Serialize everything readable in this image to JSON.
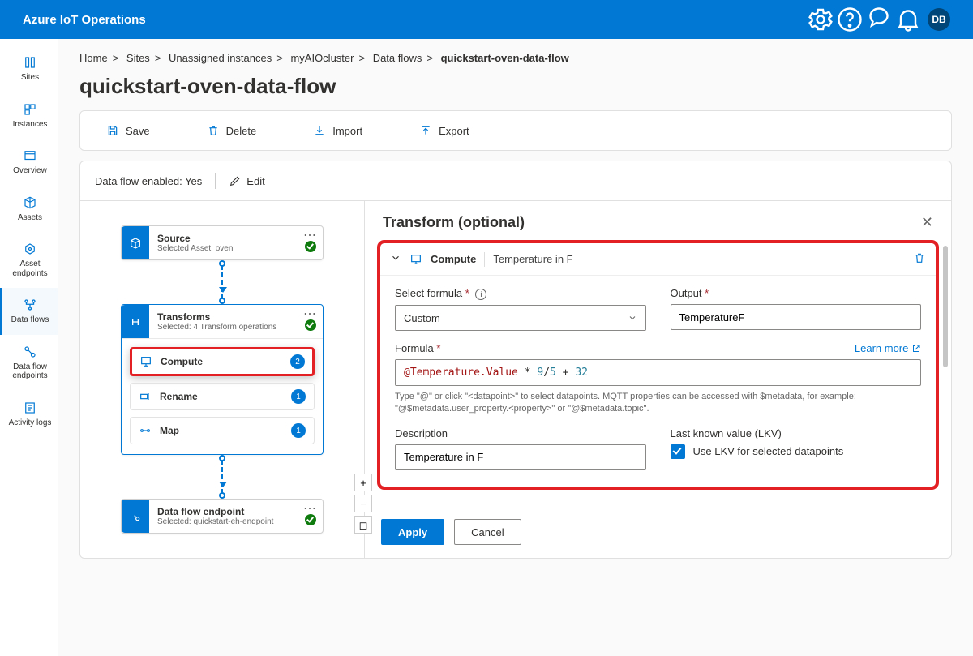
{
  "header": {
    "title": "Azure IoT Operations",
    "user_initials": "DB"
  },
  "rail": {
    "items": [
      {
        "label": "Sites",
        "icon": "book"
      },
      {
        "label": "Instances",
        "icon": "grid"
      },
      {
        "label": "Overview",
        "icon": "window"
      },
      {
        "label": "Assets",
        "icon": "cube"
      },
      {
        "label": "Asset endpoints",
        "icon": "endpoint"
      },
      {
        "label": "Data flows",
        "icon": "flow",
        "active": true
      },
      {
        "label": "Data flow endpoints",
        "icon": "flow-ep"
      },
      {
        "label": "Activity logs",
        "icon": "logs"
      }
    ]
  },
  "breadcrumbs": [
    "Home",
    "Sites",
    "Unassigned instances",
    "myAIOcluster",
    "Data flows",
    "quickstart-oven-data-flow"
  ],
  "page_title": "quickstart-oven-data-flow",
  "cmd": {
    "save": "Save",
    "delete": "Delete",
    "import": "Import",
    "export": "Export"
  },
  "editor": {
    "status_label": "Data flow enabled:",
    "status_value": "Yes",
    "edit": "Edit"
  },
  "nodes": {
    "source": {
      "title": "Source",
      "subtitle": "Selected Asset: oven"
    },
    "transforms": {
      "title": "Transforms",
      "subtitle": "Selected: 4 Transform operations",
      "items": [
        {
          "label": "Compute",
          "count": 2,
          "hi": true
        },
        {
          "label": "Rename",
          "count": 1
        },
        {
          "label": "Map",
          "count": 1
        }
      ]
    },
    "endpoint": {
      "title": "Data flow endpoint",
      "subtitle": "Selected: quickstart-eh-endpoint"
    }
  },
  "panel": {
    "title": "Transform (optional)",
    "card_title": "Compute",
    "card_sub": "Temperature in F",
    "labels": {
      "select_formula": "Select formula",
      "output": "Output",
      "formula": "Formula",
      "learn_more": "Learn more",
      "description": "Description",
      "lkv": "Last known value (LKV)",
      "lkv_check": "Use LKV for selected datapoints"
    },
    "values": {
      "formula_type": "Custom",
      "output": "TemperatureF",
      "formula_raw": "@Temperature.Value * 9/5 + 32",
      "description": "Temperature in F"
    },
    "hint": "Type \"@\" or click \"<datapoint>\" to select datapoints. MQTT properties can be accessed with $metadata, for example: \"@$metadata.user_property.<property>\" or \"@$metadata.topic\".",
    "buttons": {
      "apply": "Apply",
      "cancel": "Cancel"
    }
  }
}
